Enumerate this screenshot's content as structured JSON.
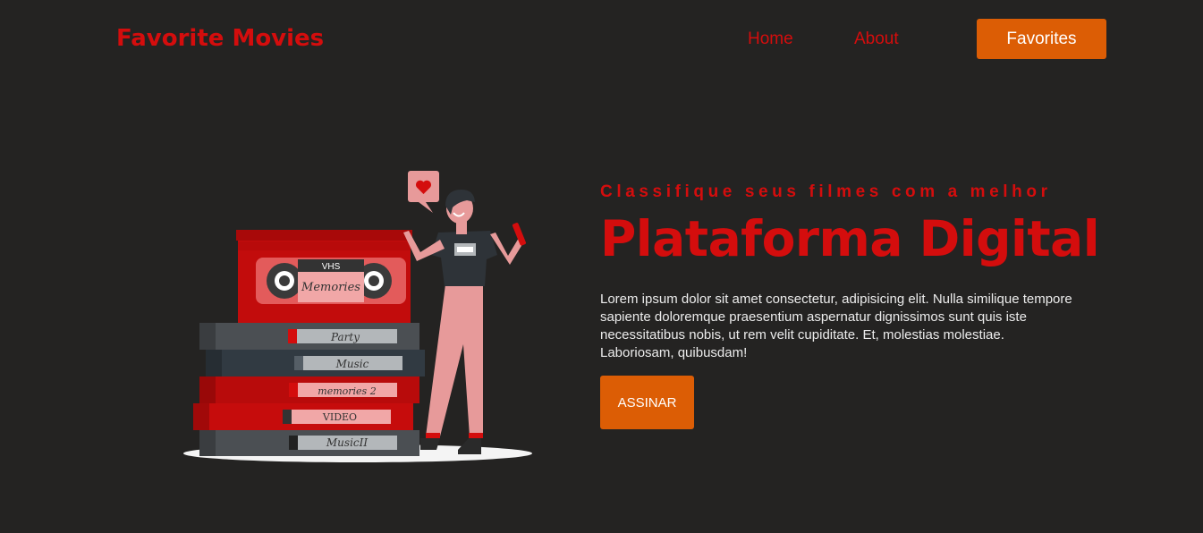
{
  "header": {
    "brand": "Favorite Movies",
    "nav": {
      "home": "Home",
      "about": "About",
      "favorites": "Favorites"
    }
  },
  "hero": {
    "kicker": "Classifique seus filmes com a melhor",
    "headline": "Plataforma Digital",
    "description": "Lorem ipsum dolor sit amet consectetur, adipisicing elit. Nulla similique tempore sapiente doloremque praesentium aspernatur dignissimos sunt quis iste necessitatibus nobis, ut rem velit cupiditate. Et, molestias molestiae. Laboriosam, quibusdam!",
    "cta": "ASSINAR"
  },
  "illustration": {
    "top_tape": {
      "brand": "VHS",
      "label": "Memories"
    },
    "tapes": [
      {
        "label": "Party"
      },
      {
        "label": "Music"
      },
      {
        "label": "memories 2"
      },
      {
        "label": "VIDEO"
      },
      {
        "label": "MusicII"
      }
    ],
    "heart_icon": "heart-icon"
  },
  "colors": {
    "accent_red": "#d40d0d",
    "accent_orange": "#dc5d05",
    "background": "#242322",
    "text_light": "#ececec"
  }
}
